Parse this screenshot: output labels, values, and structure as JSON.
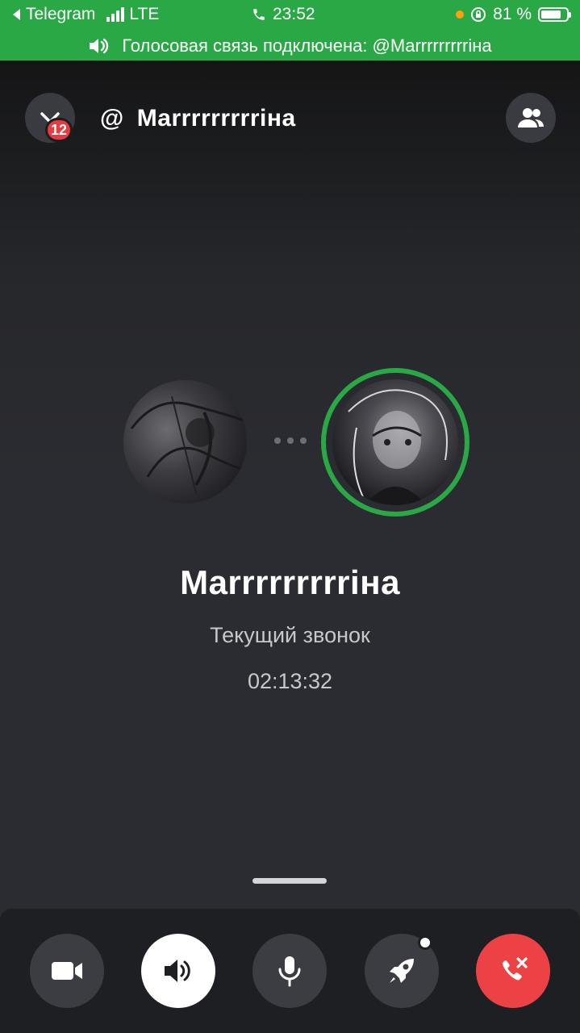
{
  "status_bar": {
    "back_app": "Telegram",
    "network": "LTE",
    "time": "23:52",
    "battery": "81 %",
    "battery_level": 0.81
  },
  "voice_banner": {
    "text": "Голосовая связь подключена: @Marrrrrrrrrіна"
  },
  "header": {
    "badge_count": "12",
    "at_symbol": "@",
    "title": "Marrrrrrrrrіна"
  },
  "call": {
    "name": "Marrrrrrrrrіна",
    "status": "Текущий звонок",
    "timer": "02:13:32"
  },
  "colors": {
    "accent_green": "#2aa846",
    "end_call_red": "#ed4245",
    "badge_red": "#e83a3f"
  },
  "icons": {
    "back": "chevron-left-icon",
    "minimize": "chevron-down-icon",
    "members": "people-icon",
    "camera": "video-camera-icon",
    "speaker": "speaker-icon",
    "mic": "microphone-icon",
    "activity": "rocket-icon",
    "end_call": "phone-hangup-icon"
  }
}
